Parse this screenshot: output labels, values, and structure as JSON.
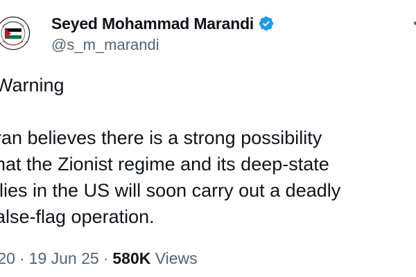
{
  "author": {
    "display_name": "Seyed Mohammad Marandi",
    "handle": "@s_m_marandi",
    "verified": true,
    "verified_color": "#1d9bf0",
    "avatar_icon": "palestine-flag-badge-avatar"
  },
  "tweet": {
    "heading": "Warning",
    "body": "ran believes there is a strong possibility\nhat the Zionist regime and its deep-state\nllies in the US will soon carry out a deadly\nalse-flag operation."
  },
  "meta": {
    "time": ":20",
    "separator": "·",
    "date": "19 Jun 25",
    "views_count": "580K",
    "views_label": "Views"
  },
  "colors": {
    "text_primary": "#0f1419",
    "text_secondary": "#536471",
    "flag_red": "#ce1126",
    "flag_green": "#007a3d",
    "flag_black": "#000000"
  }
}
